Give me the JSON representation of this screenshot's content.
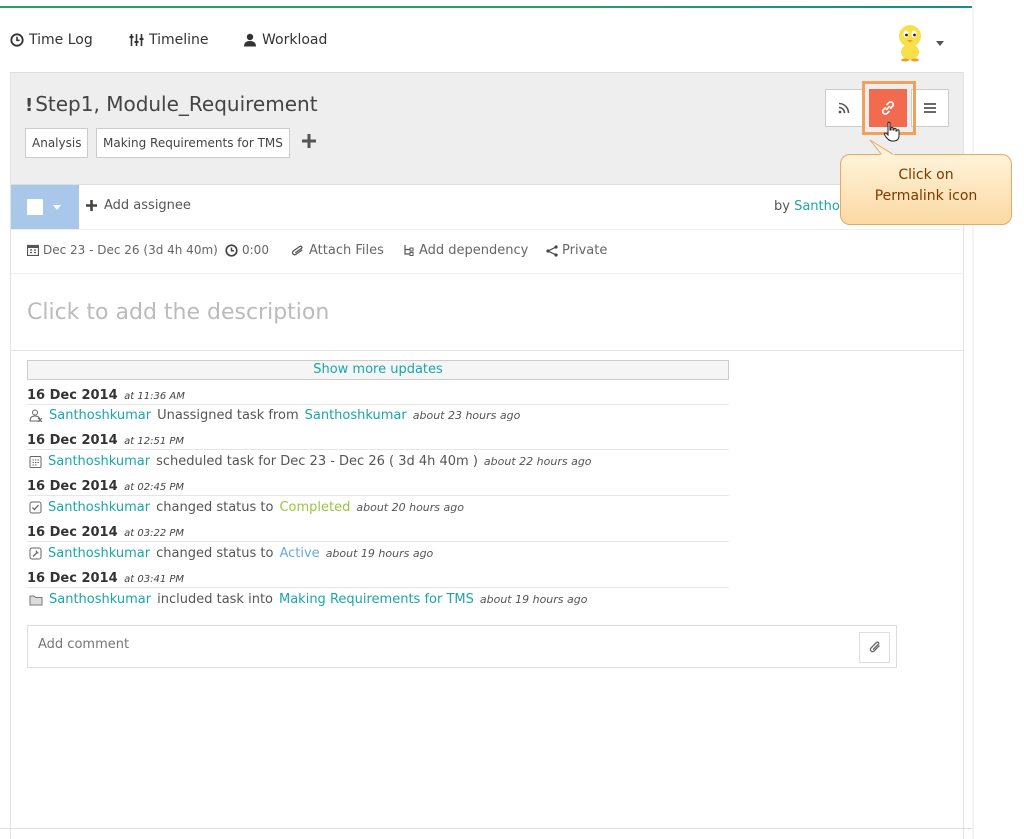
{
  "nav": {
    "time_log": "Time Log",
    "timeline": "Timeline",
    "workload": "Workload"
  },
  "task": {
    "title_prefix": "!",
    "title": "Step1, Module_Requirement",
    "tags": [
      "Analysis",
      "Making Requirements for TMS"
    ]
  },
  "callout": {
    "line1": "Click on",
    "line2": "Permalink icon"
  },
  "assign": {
    "add_assignee": "Add assignee",
    "by_prefix": "by ",
    "by_user": "Santhos"
  },
  "meta": {
    "date_range": "Dec 23 - Dec 26 (3d 4h 40m)",
    "time": "0:00",
    "attach_files": "Attach Files",
    "add_dependency": "Add dependency",
    "private": "Private"
  },
  "description_placeholder": "Click to add the description",
  "show_more_updates": "Show more updates",
  "updates": [
    {
      "date": "16 Dec 2014",
      "at": "at 11:36 AM",
      "icon": "unassign-user-icon",
      "user": "Santhoshkumar",
      "text": "Unassigned task from",
      "target": "Santhoshkumar",
      "ago": "about 23 hours ago"
    },
    {
      "date": "16 Dec 2014",
      "at": "at 12:51 PM",
      "icon": "calendar-icon",
      "user": "Santhoshkumar",
      "text": "scheduled task for Dec 23 - Dec 26 ( 3d 4h 40m )",
      "target": "",
      "ago": "about 22 hours ago"
    },
    {
      "date": "16 Dec 2014",
      "at": "at 02:45 PM",
      "icon": "checkbox-icon",
      "user": "Santhoshkumar",
      "text": "changed status to",
      "target": "Completed",
      "ago": "about 20 hours ago"
    },
    {
      "date": "16 Dec 2014",
      "at": "at 03:22 PM",
      "icon": "wrench-icon",
      "user": "Santhoshkumar",
      "text": "changed status to",
      "target": "Active",
      "ago": "about 19 hours ago"
    },
    {
      "date": "16 Dec 2014",
      "at": "at 03:41 PM",
      "icon": "folder-icon",
      "user": "Santhoshkumar",
      "text": "included task into",
      "target": "Making Requirements for TMS",
      "ago": "about 19 hours ago"
    }
  ],
  "comment": {
    "placeholder": "Add comment"
  },
  "colors": {
    "accent": "#1aa6a6",
    "permalink_button": "#f36b4f",
    "completed": "#9bc53d",
    "active": "#6aa9dc",
    "checkbox_bg": "#a9c7e8"
  }
}
